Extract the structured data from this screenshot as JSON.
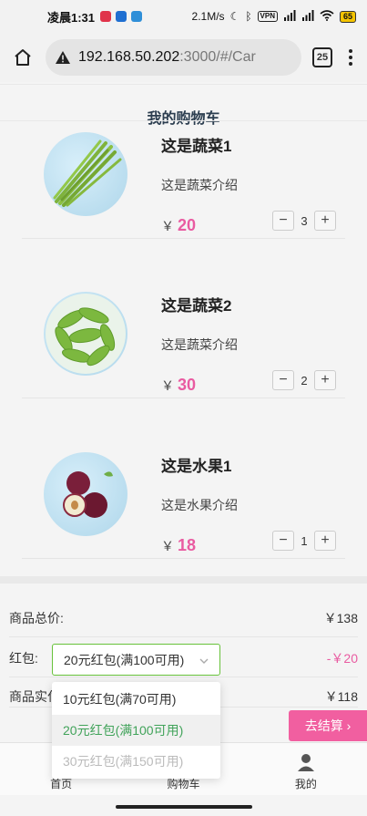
{
  "statusbar": {
    "time": "凌晨1:31",
    "speed": "2.1M/s",
    "vpn": "VPN",
    "battery": "65"
  },
  "browser": {
    "url_host": "192.168.50.202",
    "url_path": ":3000/#/Car",
    "tab_count": "25"
  },
  "page": {
    "title": "我的购物车"
  },
  "goods": [
    {
      "name": "这是蔬菜1",
      "desc": "这是蔬菜介绍",
      "currency": "￥",
      "price": "20",
      "qty": "3",
      "image": "asparagus"
    },
    {
      "name": "这是蔬菜2",
      "desc": "这是蔬菜介绍",
      "currency": "￥",
      "price": "30",
      "qty": "2",
      "image": "peas"
    },
    {
      "name": "这是水果1",
      "desc": "这是水果介绍",
      "currency": "￥",
      "price": "18",
      "qty": "1",
      "image": "plums"
    }
  ],
  "stepper": {
    "minus": "−",
    "plus": "+"
  },
  "summary": {
    "total_label": "商品总价:",
    "total_value": "￥138",
    "coupon_label": "红包:",
    "coupon_value": "-￥20",
    "actual_label": "商品实付",
    "actual_value": "￥118",
    "selected_coupon": "20元红包(满100可用)"
  },
  "coupon_options": [
    {
      "label": "10元红包(满70可用)",
      "state": "normal"
    },
    {
      "label": "20元红包(满100可用)",
      "state": "selected"
    },
    {
      "label": "30元红包(满150可用)",
      "state": "disabled"
    }
  ],
  "checkout": {
    "label": "去结算",
    "arrow": "›"
  },
  "tabbar": [
    {
      "label": "首页",
      "icon": "home-icon"
    },
    {
      "label": "购物车",
      "icon": "cart-icon"
    },
    {
      "label": "我的",
      "icon": "user-icon"
    }
  ],
  "colors": {
    "accent": "#e95ba1",
    "checkout": "#f15fa0",
    "select_border": "#67c23a",
    "selected_option": "#41a35a"
  }
}
